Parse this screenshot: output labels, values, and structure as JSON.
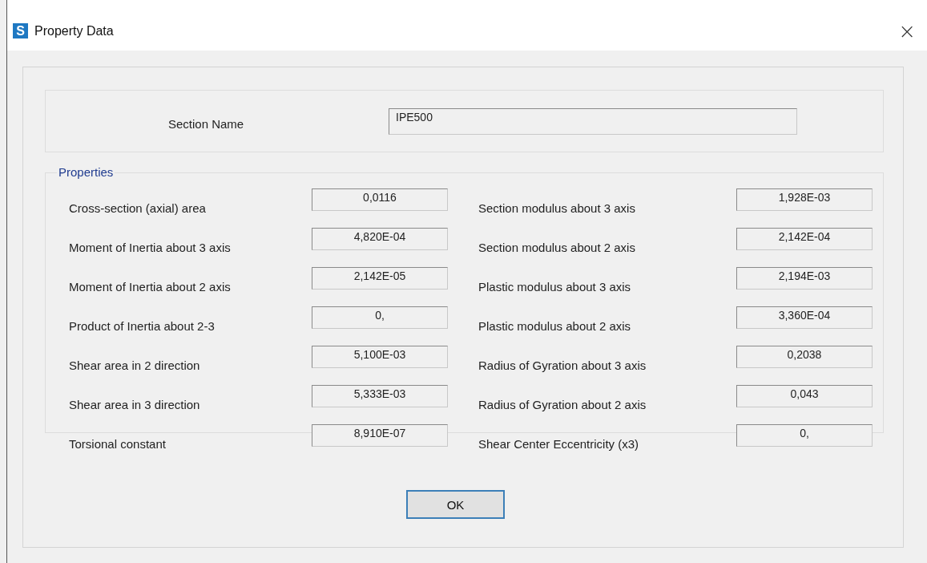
{
  "window": {
    "icon_letter": "S",
    "title": "Property Data",
    "close": "×"
  },
  "section": {
    "label": "Section Name",
    "value": "IPE500"
  },
  "properties": {
    "title": "Properties",
    "left": [
      {
        "label": "Cross-section (axial) area",
        "value": "0,0116"
      },
      {
        "label": "Moment of Inertia about 3 axis",
        "value": "4,820E-04"
      },
      {
        "label": "Moment of Inertia about 2 axis",
        "value": "2,142E-05"
      },
      {
        "label": "Product of Inertia about 2-3",
        "value": "0,"
      },
      {
        "label": "Shear area in 2 direction",
        "value": "5,100E-03"
      },
      {
        "label": "Shear area in 3 direction",
        "value": "5,333E-03"
      },
      {
        "label": "Torsional constant",
        "value": "8,910E-07"
      }
    ],
    "right": [
      {
        "label": "Section modulus about 3 axis",
        "value": "1,928E-03"
      },
      {
        "label": "Section modulus about 2 axis",
        "value": "2,142E-04"
      },
      {
        "label": "Plastic modulus about 3 axis",
        "value": "2,194E-03"
      },
      {
        "label": "Plastic modulus about 2 axis",
        "value": "3,360E-04"
      },
      {
        "label": "Radius of Gyration about 3 axis",
        "value": "0,2038"
      },
      {
        "label": "Radius of Gyration about 2 axis",
        "value": "0,043"
      },
      {
        "label": "Shear Center Eccentricity (x3)",
        "value": "0,"
      }
    ]
  },
  "buttons": [
    "OK"
  ]
}
